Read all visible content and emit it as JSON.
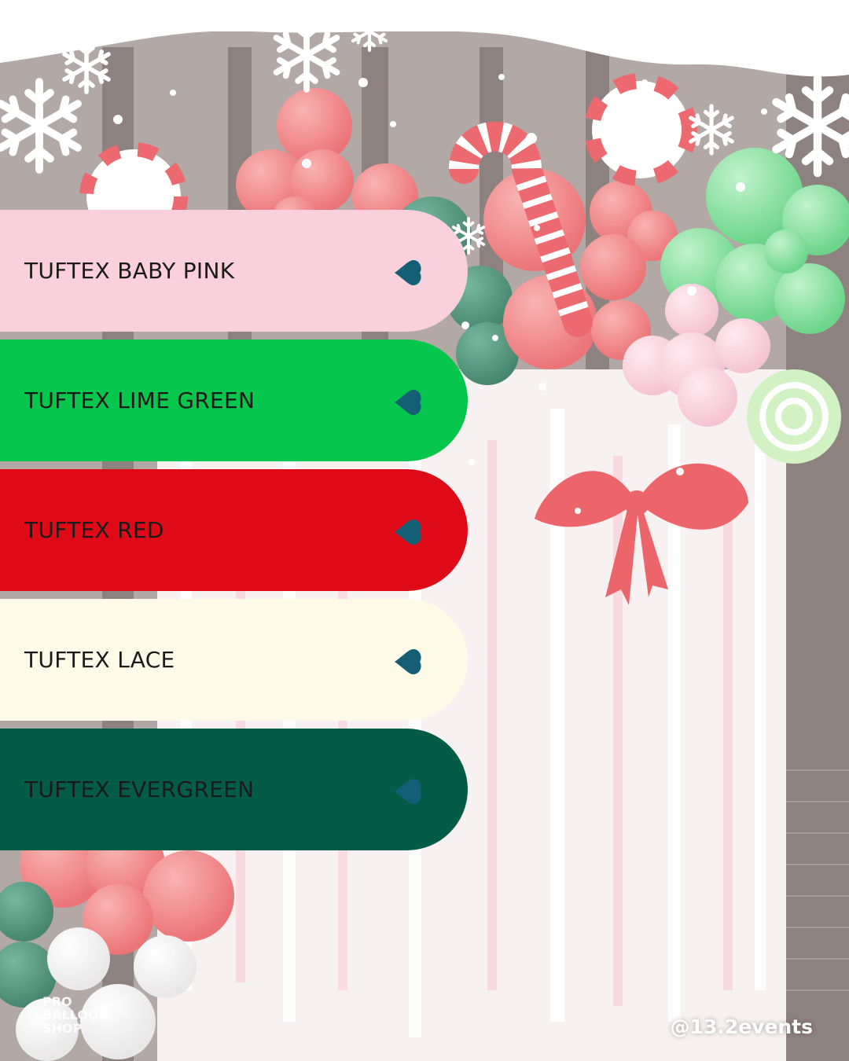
{
  "swatches": [
    {
      "label": "TUFTEX BABY PINK",
      "color": "#f9d0dc"
    },
    {
      "label": "TUFTEX LIME GREEN",
      "color": "#06c64e"
    },
    {
      "label": "TUFTEX RED",
      "color": "#de0a18"
    },
    {
      "label": "TUFTEX LACE",
      "color": "#fdfbe8"
    },
    {
      "label": "TUFTEX EVERGREEN",
      "color": "#045c48"
    }
  ],
  "heart_icon": {
    "name": "heart-icon",
    "color": "#145e76"
  },
  "logo": {
    "line1": "PRO",
    "line2": "BALLOON",
    "line3": "SHOP"
  },
  "credit": "@13.2events",
  "colors": {
    "balloon_red": "#e85a5e",
    "balloon_green": "#5fd37e",
    "balloon_evergreen": "#2c7a5a",
    "balloon_pink": "#f6c3d0",
    "backdrop_wood": "#6b5a55"
  }
}
